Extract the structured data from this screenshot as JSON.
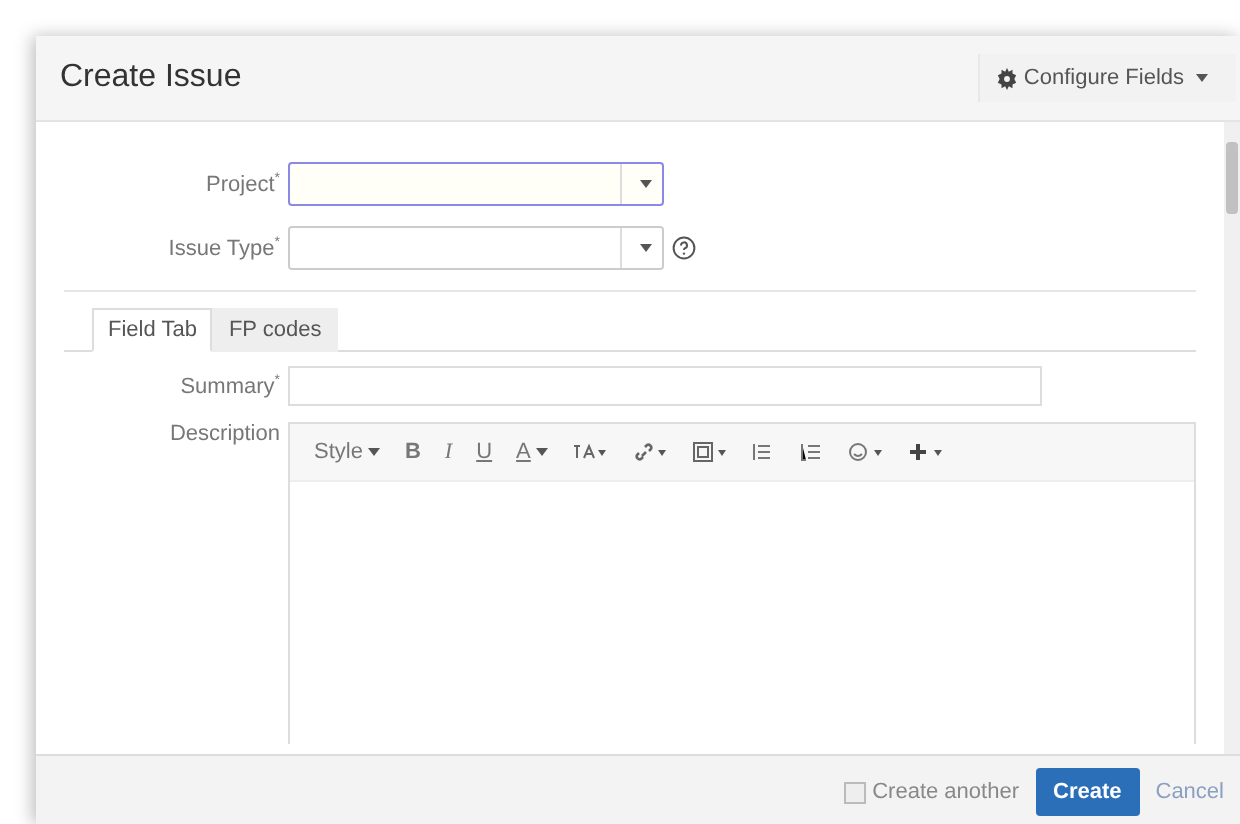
{
  "dialog": {
    "title": "Create Issue",
    "configure_button": "Configure Fields"
  },
  "fields": [
    {
      "label": "Project",
      "required_mark": "*",
      "focused": true,
      "help": false
    },
    {
      "label": "Issue Type",
      "required_mark": "*",
      "focused": false,
      "help": true
    }
  ],
  "tabs": [
    {
      "label": "Field Tab",
      "selected": true
    },
    {
      "label": "FP codes",
      "selected": false
    }
  ],
  "summary": {
    "label": "Summary",
    "required_mark": "*"
  },
  "description": {
    "label": "Description",
    "toolbar": [
      {
        "label": "Style",
        "dropdown": true
      },
      {
        "label": "B",
        "dropdown": false
      },
      {
        "label": "I",
        "dropdown": false
      },
      {
        "label": "U",
        "dropdown": false
      },
      {
        "label": "A",
        "dropdown": true
      }
    ]
  },
  "footer": {
    "create_another": {
      "label": "Create another",
      "checked": false
    },
    "create_button": "Create",
    "cancel_link": "Cancel"
  }
}
